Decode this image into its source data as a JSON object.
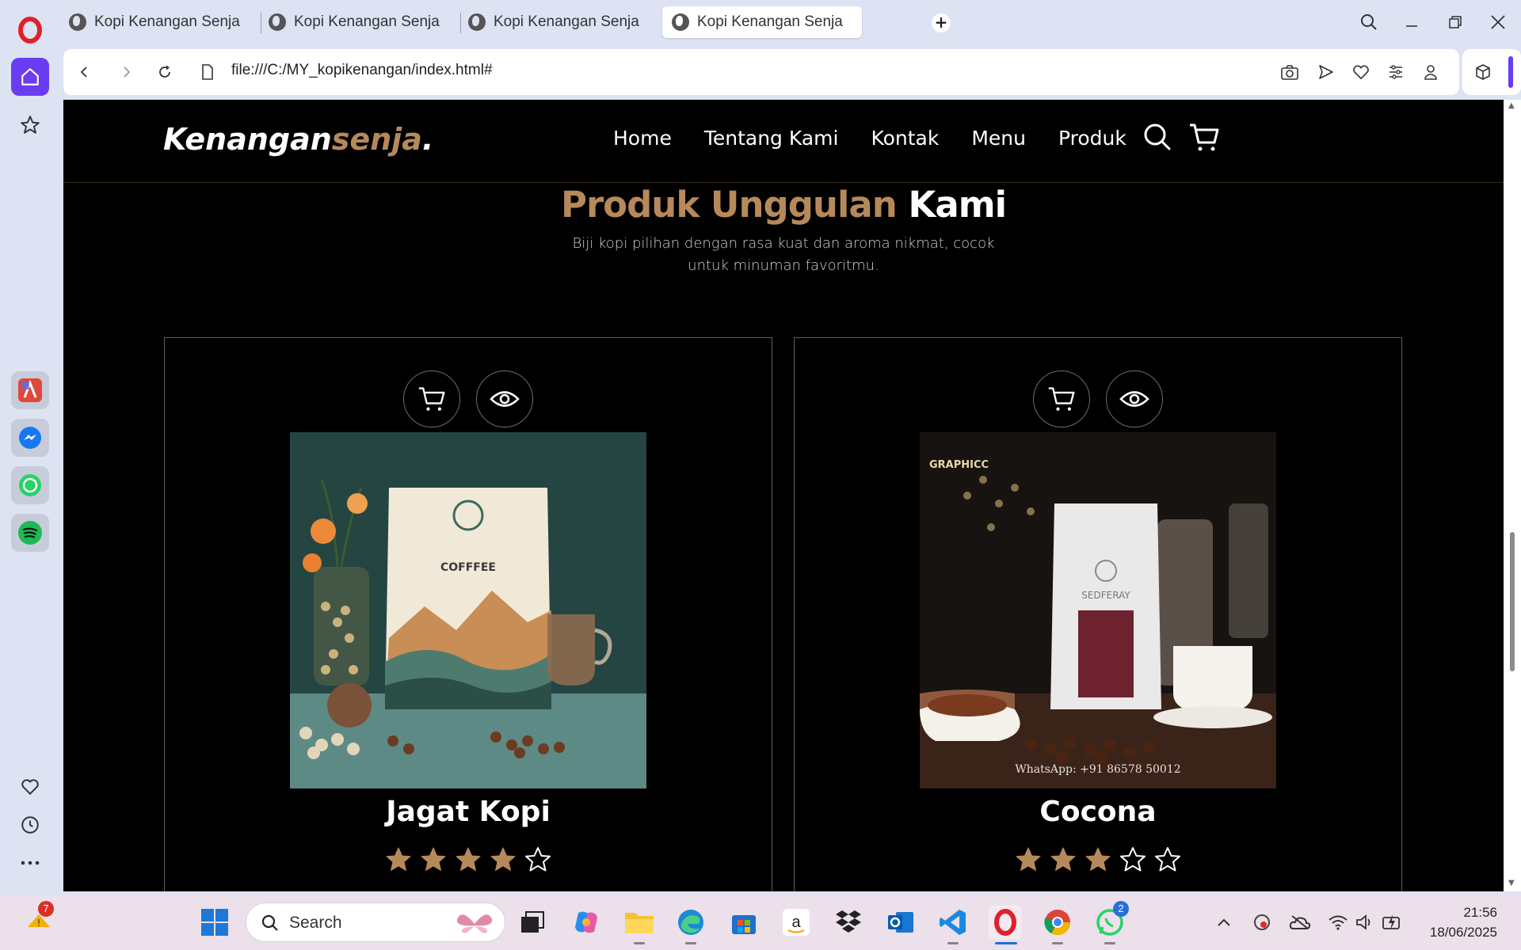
{
  "browser": {
    "tabs": [
      {
        "label": "Kopi Kenangan Senja",
        "active": false
      },
      {
        "label": "Kopi Kenangan Senja",
        "active": false
      },
      {
        "label": "Kopi Kenangan Senja",
        "active": false
      },
      {
        "label": "Kopi Kenangan Senja",
        "active": true
      }
    ],
    "new_tab_label": "+",
    "url": "file:///C:/MY_kopikenangan/index.html#",
    "accent_color": "#6a3cf2"
  },
  "site": {
    "logo_main": "Kenangan",
    "logo_accent": "senja",
    "logo_dot": ".",
    "nav": [
      "Home",
      "Tentang Kami",
      "Kontak",
      "Menu",
      "Produk"
    ],
    "accent_color": "#b6895b"
  },
  "section": {
    "title_accent": "Produk Unggulan",
    "title_white": "Kami",
    "subtitle": "Biji kopi pilihan dengan rasa kuat dan aroma nikmat, cocok untuk minuman favoritmu."
  },
  "products": [
    {
      "name": "Jagat Kopi",
      "rating": 4,
      "max_rating": 5,
      "image_text": "COFFFEE"
    },
    {
      "name": "Cocona",
      "rating": 3,
      "max_rating": 5,
      "image_text": "SEDFERAY",
      "image_text_2": "WhatsApp: +91 86578 50012",
      "image_logo": "GRAPHICC"
    }
  ],
  "taskbar": {
    "search_placeholder": "Search",
    "weather_badge": "7",
    "whatsapp_badge": "2",
    "time": "21:56",
    "date": "18/06/2025"
  }
}
